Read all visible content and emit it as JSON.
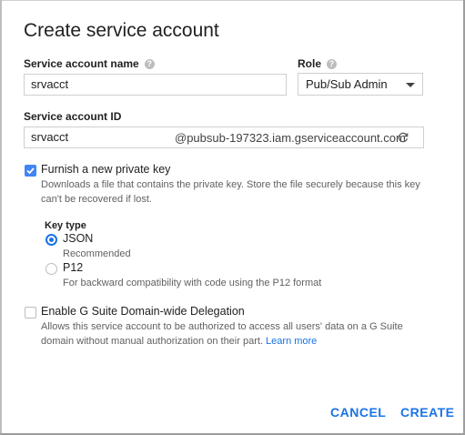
{
  "dialog": {
    "title": "Create service account"
  },
  "fields": {
    "name_label": "Service account name",
    "name_value": "srvacct",
    "role_label": "Role",
    "role_value": "Pub/Sub Admin",
    "id_label": "Service account ID",
    "id_value": "srvacct",
    "id_suffix": "@pubsub-197323.iam.gserviceaccount.com"
  },
  "private_key": {
    "checked": true,
    "label": "Furnish a new private key",
    "desc": "Downloads a file that contains the private key. Store the file securely because this key can't be recovered if lost.",
    "key_type_label": "Key type",
    "options": [
      {
        "label": "JSON",
        "desc": "Recommended",
        "selected": true
      },
      {
        "label": "P12",
        "desc": "For backward compatibility with code using the P12 format",
        "selected": false
      }
    ]
  },
  "delegation": {
    "checked": false,
    "label": "Enable G Suite Domain-wide Delegation",
    "desc": "Allows this service account to be authorized to access all users' data on a G Suite domain without manual authorization on their part.",
    "learn_more": "Learn more"
  },
  "actions": {
    "cancel": "CANCEL",
    "create": "CREATE"
  },
  "colors": {
    "accent": "#1a73e8",
    "checkbox": "#4285f4"
  }
}
